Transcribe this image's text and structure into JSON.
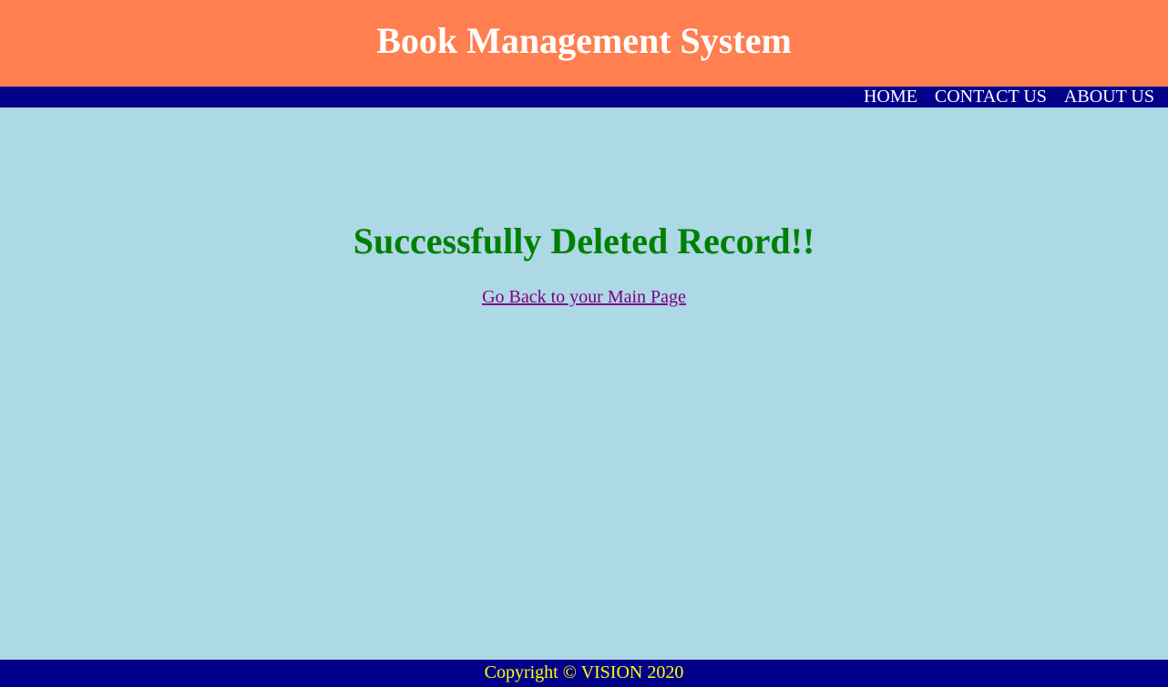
{
  "header": {
    "title": "Book Management System"
  },
  "nav": {
    "items": [
      {
        "label": "HOME"
      },
      {
        "label": "CONTACT US"
      },
      {
        "label": "ABOUT US"
      }
    ]
  },
  "main": {
    "message": "Successfully Deleted Record!!",
    "back_link": "Go Back to your Main Page"
  },
  "footer": {
    "copyright": "Copyright © VISION 2020"
  },
  "colors": {
    "header_bg": "#ff7f50",
    "nav_bg": "#00008b",
    "page_bg": "#add8e6",
    "success_text": "#008000",
    "link_visited": "#800080",
    "footer_text": "#ffff00"
  }
}
